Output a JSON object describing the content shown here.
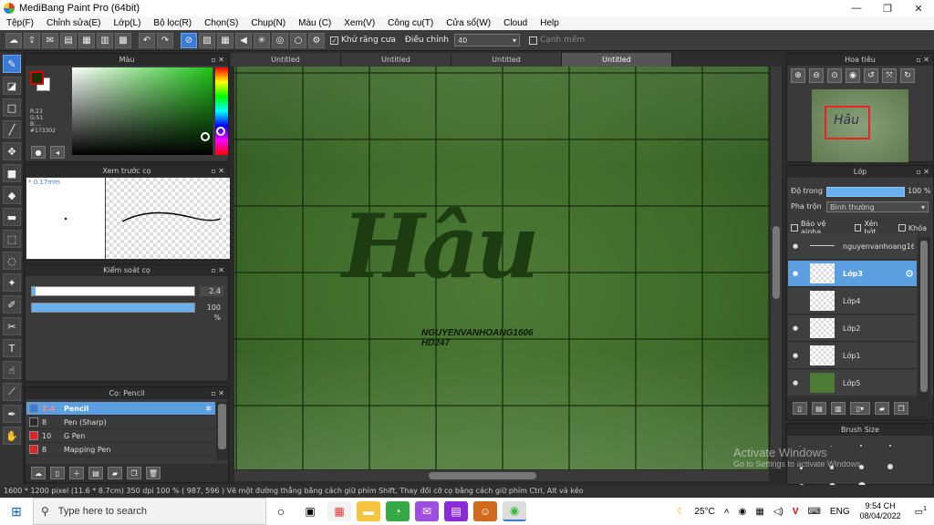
{
  "window": {
    "title": "MediBang Paint Pro (64bit)",
    "buttons": [
      "—",
      "❐",
      "✕"
    ]
  },
  "menu": [
    "Tệp(F)",
    "Chỉnh sửa(E)",
    "Lớp(L)",
    "Bộ lọc(R)",
    "Chọn(S)",
    "Chụp(N)",
    "Màu (C)",
    "Xem(V)",
    "Công cụ(T)",
    "Cửa sổ(W)",
    "Cloud",
    "Help"
  ],
  "toolbar": {
    "antialias_label": "Khử răng cưa",
    "correction_label": "Điều chỉnh",
    "correction_value": "40",
    "edge_label": "Cạnh mềm"
  },
  "color_panel": {
    "title": "Màu",
    "readout": [
      "R:23",
      "G:51",
      "B:...",
      "#173302"
    ],
    "fg_color": "#173302"
  },
  "brush_preview": {
    "title": "Xem trước cọ",
    "size_label": "* 0.17mm"
  },
  "brush_control": {
    "title": "Kiểm soát cọ",
    "size_value": "2.4",
    "opacity_value": "100 %",
    "opacity_fraction": 1.0
  },
  "brush_list": {
    "title": "Cọ: Pencil",
    "items": [
      {
        "size": "2.4",
        "name": "Pencil",
        "color": "#3b7bd6"
      },
      {
        "size": "8",
        "name": "Pen (Sharp)",
        "color": "#2b2b2b"
      },
      {
        "size": "10",
        "name": "G Pen",
        "color": "#e02424"
      },
      {
        "size": "8",
        "name": "Mapping Pen",
        "color": "#e02424"
      }
    ]
  },
  "tabs": [
    "Untitled",
    "Untitled",
    "Untitled",
    "Untitled"
  ],
  "canvas": {
    "title_text": "Hâu",
    "watermark_line1": "NGUYENVANHOANG1606",
    "watermark_line2": "HD247"
  },
  "navigator": {
    "title": "Hoa tiêu",
    "thumb_text": "Hâu"
  },
  "layer_panel": {
    "title": "Lớp",
    "opacity_label": "Độ trong",
    "opacity_value": "100 %",
    "blend_label": "Pha trộn",
    "blend_value": "Bình thường",
    "protect_alpha": "Bảo vệ alpha",
    "clipping": "Xén bớt",
    "lock": "Khóa",
    "layers": [
      "nguyenvanhoang16",
      "Lớp3",
      "Lớp4",
      "Lớp2",
      "Lớp1",
      "Lớp5"
    ]
  },
  "brush_size": {
    "title": "Brush Size"
  },
  "status": {
    "text": "1600 * 1200 pixel   (11.6 * 8.7cm)   350 dpi   100 %   ( 987, 596 )   Vẽ một đường thẳng bằng cách giữ phím Shift, Thay đổi cỡ cọ bằng cách giữ phím Ctrl, Alt và kéo"
  },
  "activate": {
    "line1": "Activate Windows",
    "line2": "Go to Settings to activate Windows."
  },
  "taskbar": {
    "search_placeholder": "Type here to search",
    "temperature": "25°C",
    "language": "ENG",
    "time": "9:54 CH",
    "date": "08/04/2022",
    "notifications": "1"
  }
}
